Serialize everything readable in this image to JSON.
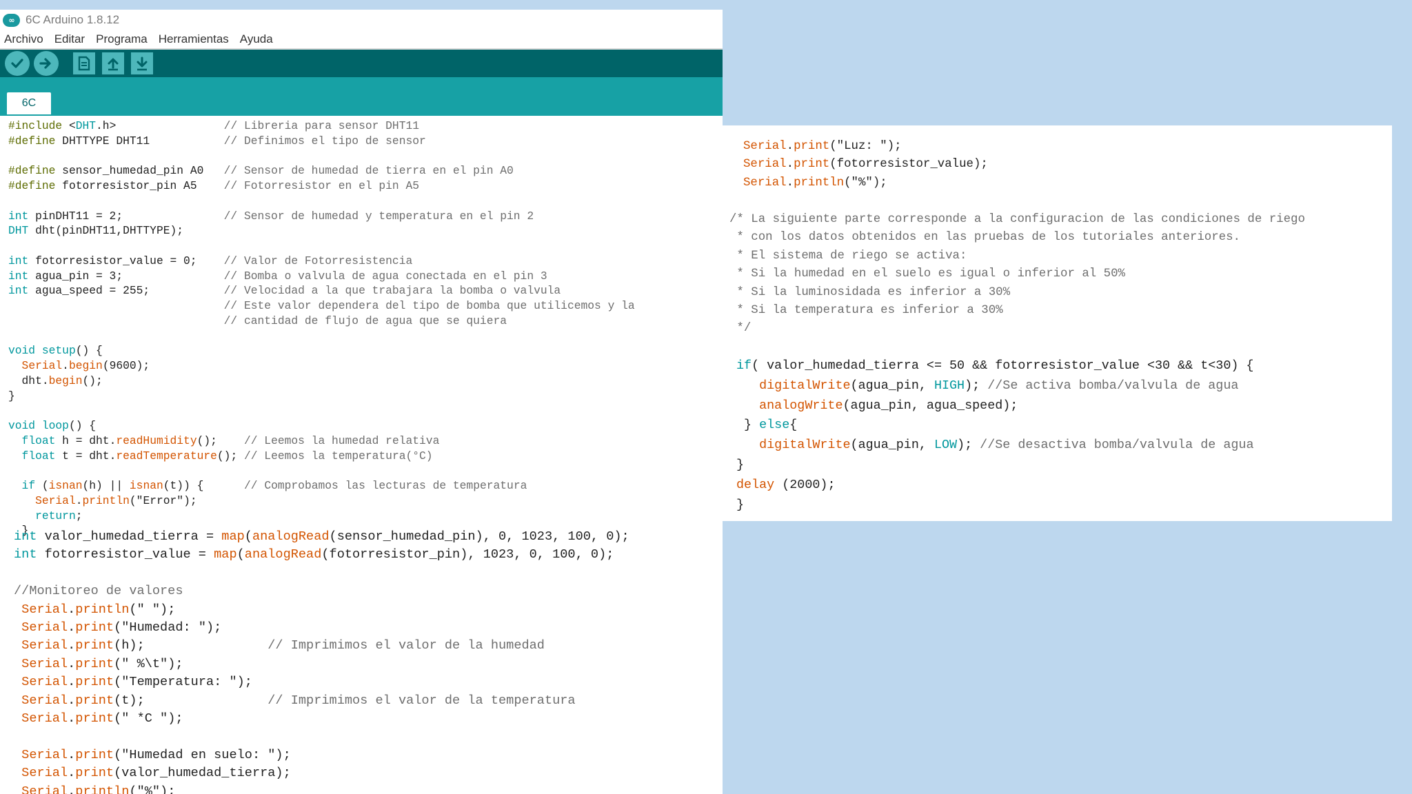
{
  "window": {
    "title": "6C Arduino 1.8.12",
    "logo_text": "∞"
  },
  "menu": [
    "Archivo",
    "Editar",
    "Programa",
    "Herramientas",
    "Ayuda"
  ],
  "toolbar": {
    "buttons": [
      "verify-icon",
      "upload-icon",
      "new-icon",
      "open-icon",
      "save-icon"
    ],
    "color_bg": "#006468",
    "color_button": "#4db7bb"
  },
  "tab": {
    "label": "6C"
  },
  "colors": {
    "keyword": "#00979d",
    "function": "#d35400",
    "preprocessor": "#5e6d03",
    "comment": "#6e6e6e",
    "tabbar": "#17a1a5"
  },
  "code": {
    "block1": [
      "#include <DHT.h>                // Libreria para sensor DHT11",
      "#define DHTTYPE DHT11           // Definimos el tipo de sensor",
      "",
      "#define sensor_humedad_pin A0   // Sensor de humedad de tierra en el pin A0",
      "#define fotorresistor_pin A5    // Fotorresistor en el pin A5",
      "",
      "int pinDHT11 = 2;               // Sensor de humedad y temperatura en el pin 2",
      "DHT dht(pinDHT11,DHTTYPE);",
      "",
      "int fotorresistor_value = 0;    // Valor de Fotorresistencia",
      "int agua_pin = 3;               // Bomba o valvula de agua conectada en el pin 3",
      "int agua_speed = 255;           // Velocidad a la que trabajara la bomba o valvula",
      "                                // Este valor dependera del tipo de bomba que utilicemos y la",
      "                                // cantidad de flujo de agua que se quiera",
      "",
      "void setup() {",
      "  Serial.begin(9600);",
      "  dht.begin();",
      "}",
      "",
      "void loop() {",
      "  float h = dht.readHumidity();    // Leemos la humedad relativa",
      "  float t = dht.readTemperature(); // Leemos la temperatura(°C)",
      "",
      "  if (isnan(h) || isnan(t)) {      // Comprobamos las lecturas de temperatura",
      "    Serial.println(\"Error\");",
      "    return;",
      "  }"
    ],
    "block2": [
      "int valor_humedad_tierra = map(analogRead(sensor_humedad_pin), 0, 1023, 100, 0);",
      "int fotorresistor_value = map(analogRead(fotorresistor_pin), 1023, 0, 100, 0);",
      "",
      "//Monitoreo de valores",
      " Serial.println(\" \");",
      " Serial.print(\"Humedad: \");",
      " Serial.print(h);                // Imprimimos el valor de la humedad",
      " Serial.print(\" %\\t\");",
      " Serial.print(\"Temperatura: \");",
      " Serial.print(t);                // Imprimimos el valor de la temperatura",
      " Serial.print(\" *C \");",
      "",
      " Serial.print(\"Humedad en suelo: \");",
      " Serial.print(valor_humedad_tierra);",
      " Serial.println(\"%\");"
    ],
    "panel_a": [
      "Serial.print(\"Luz: \");",
      "Serial.print(fotorresistor_value);",
      "Serial.println(\"%\");"
    ],
    "panel_b": [
      "/* La siguiente parte corresponde a la configuracion de las condiciones de riego",
      " * con los datos obtenidos en las pruebas de los tutoriales anteriores.",
      " * El sistema de riego se activa:",
      " * Si la humedad en el suelo es igual o inferior al 50%",
      " * Si la luminosidada es inferior a 30%",
      " * Si la temperatura es inferior a 30%",
      " */"
    ],
    "panel_c": [
      "if( valor_humedad_tierra <= 50 && fotorresistor_value <30 && t<30) {",
      "   digitalWrite(agua_pin, HIGH); //Se activa bomba/valvula de agua",
      "   analogWrite(agua_pin, agua_speed);",
      " } else{",
      "   digitalWrite(agua_pin, LOW); //Se desactiva bomba/valvula de agua",
      "}",
      "delay (2000);",
      "}"
    ]
  }
}
